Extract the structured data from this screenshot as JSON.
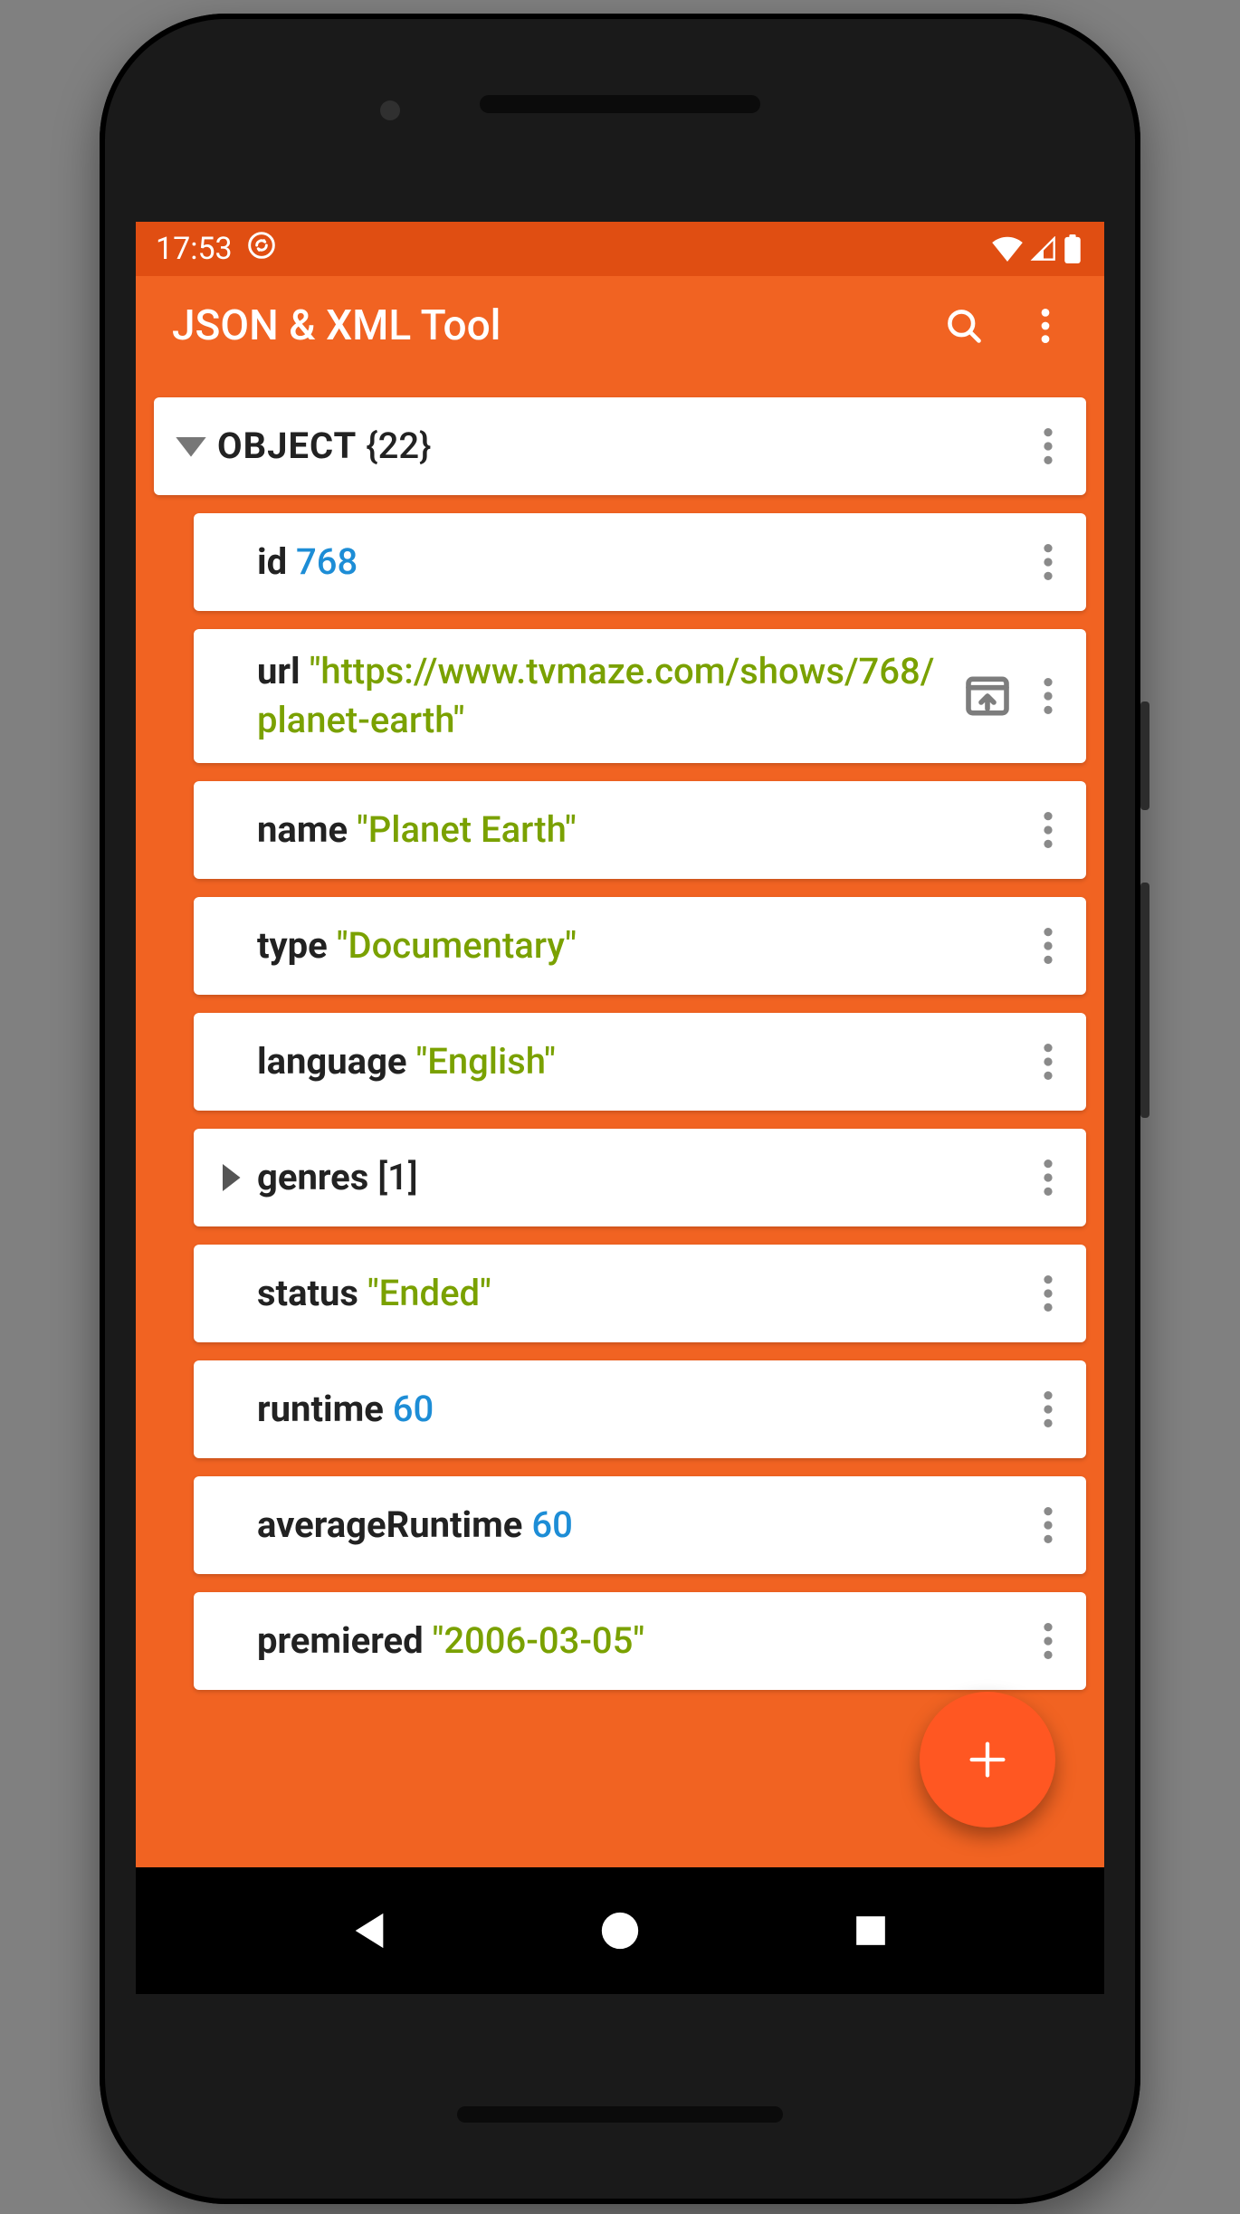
{
  "status": {
    "time": "17:53"
  },
  "appbar": {
    "title": "JSON & XML Tool"
  },
  "root": {
    "label": "OBJECT",
    "count": "{22}"
  },
  "items": [
    {
      "key": "id",
      "type": "number",
      "value": "768"
    },
    {
      "key": "url",
      "type": "string",
      "value": "\"https://www.tvmaze.com/shows/768/planet-earth\"",
      "hasLink": true
    },
    {
      "key": "name",
      "type": "string",
      "value": "\"Planet Earth\""
    },
    {
      "key": "type",
      "type": "string",
      "value": "\"Documentary\""
    },
    {
      "key": "language",
      "type": "string",
      "value": "\"English\""
    },
    {
      "key": "genres",
      "type": "array",
      "value": "[1]",
      "expandable": true
    },
    {
      "key": "status",
      "type": "string",
      "value": "\"Ended\""
    },
    {
      "key": "runtime",
      "type": "number",
      "value": "60"
    },
    {
      "key": "averageRuntime",
      "type": "number",
      "value": "60"
    },
    {
      "key": "premiered",
      "type": "string",
      "value": "\"2006-03-05\""
    }
  ]
}
